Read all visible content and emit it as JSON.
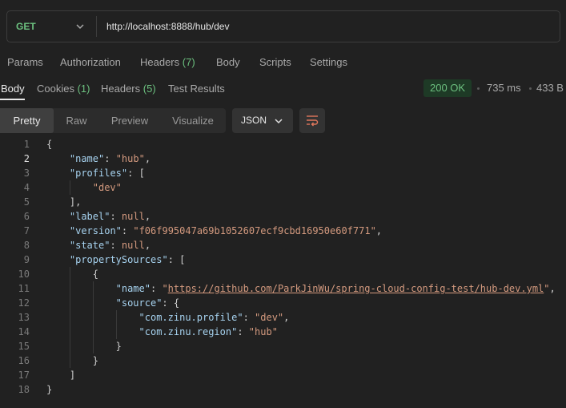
{
  "request": {
    "method": "GET",
    "url": "http://localhost:8888/hub/dev"
  },
  "request_tabs": [
    {
      "label": "Params"
    },
    {
      "label": "Authorization"
    },
    {
      "label": "Headers",
      "count": "(7)"
    },
    {
      "label": "Body"
    },
    {
      "label": "Scripts"
    },
    {
      "label": "Settings"
    }
  ],
  "response_tabs": [
    {
      "label": "Body"
    },
    {
      "label": "Cookies",
      "count": "(1)"
    },
    {
      "label": "Headers",
      "count": "(5)"
    },
    {
      "label": "Test Results"
    }
  ],
  "response_meta": {
    "status": "200 OK",
    "time": "735 ms",
    "size": "433 B"
  },
  "view_modes": [
    "Pretty",
    "Raw",
    "Preview",
    "Visualize"
  ],
  "format": "JSON",
  "colors": {
    "method": "#6cc07f",
    "status_bg": "#1e3a26",
    "json_key": "#a7d3f0",
    "json_string": "#d49a7f"
  },
  "icons": {
    "method_dropdown": "chevron-down-icon",
    "format_dropdown": "chevron-down-icon",
    "wrap": "wrap-lines-icon"
  },
  "code_lines": [
    {
      "n": "1",
      "ind": 0,
      "toks": [
        {
          "t": "p",
          "v": "{"
        }
      ]
    },
    {
      "n": "2",
      "ind": 1,
      "toks": [
        {
          "t": "k",
          "v": "\"name\""
        },
        {
          "t": "p",
          "v": ": "
        },
        {
          "t": "s",
          "v": "\"hub\""
        },
        {
          "t": "p",
          "v": ","
        }
      ]
    },
    {
      "n": "3",
      "ind": 1,
      "toks": [
        {
          "t": "k",
          "v": "\"profiles\""
        },
        {
          "t": "p",
          "v": ": ["
        }
      ]
    },
    {
      "n": "4",
      "ind": 2,
      "toks": [
        {
          "t": "s",
          "v": "\"dev\""
        }
      ]
    },
    {
      "n": "5",
      "ind": 1,
      "toks": [
        {
          "t": "p",
          "v": "],"
        }
      ]
    },
    {
      "n": "6",
      "ind": 1,
      "toks": [
        {
          "t": "k",
          "v": "\"label\""
        },
        {
          "t": "p",
          "v": ": "
        },
        {
          "t": "n",
          "v": "null"
        },
        {
          "t": "p",
          "v": ","
        }
      ]
    },
    {
      "n": "7",
      "ind": 1,
      "toks": [
        {
          "t": "k",
          "v": "\"version\""
        },
        {
          "t": "p",
          "v": ": "
        },
        {
          "t": "s",
          "v": "\"f06f995047a69b1052607ecf9cbd16950e60f771\""
        },
        {
          "t": "p",
          "v": ","
        }
      ]
    },
    {
      "n": "8",
      "ind": 1,
      "toks": [
        {
          "t": "k",
          "v": "\"state\""
        },
        {
          "t": "p",
          "v": ": "
        },
        {
          "t": "n",
          "v": "null"
        },
        {
          "t": "p",
          "v": ","
        }
      ]
    },
    {
      "n": "9",
      "ind": 1,
      "toks": [
        {
          "t": "k",
          "v": "\"propertySources\""
        },
        {
          "t": "p",
          "v": ": ["
        }
      ]
    },
    {
      "n": "10",
      "ind": 2,
      "toks": [
        {
          "t": "p",
          "v": "{"
        }
      ]
    },
    {
      "n": "11",
      "ind": 3,
      "toks": [
        {
          "t": "k",
          "v": "\"name\""
        },
        {
          "t": "p",
          "v": ": "
        },
        {
          "t": "s",
          "v": "\""
        },
        {
          "t": "u",
          "v": "https://github.com/ParkJinWu/spring-cloud-config-test/hub-dev.yml"
        },
        {
          "t": "s",
          "v": "\""
        },
        {
          "t": "p",
          "v": ","
        }
      ]
    },
    {
      "n": "12",
      "ind": 3,
      "toks": [
        {
          "t": "k",
          "v": "\"source\""
        },
        {
          "t": "p",
          "v": ": {"
        }
      ]
    },
    {
      "n": "13",
      "ind": 4,
      "toks": [
        {
          "t": "k",
          "v": "\"com.zinu.profile\""
        },
        {
          "t": "p",
          "v": ": "
        },
        {
          "t": "s",
          "v": "\"dev\""
        },
        {
          "t": "p",
          "v": ","
        }
      ]
    },
    {
      "n": "14",
      "ind": 4,
      "toks": [
        {
          "t": "k",
          "v": "\"com.zinu.region\""
        },
        {
          "t": "p",
          "v": ": "
        },
        {
          "t": "s",
          "v": "\"hub\""
        }
      ]
    },
    {
      "n": "15",
      "ind": 3,
      "toks": [
        {
          "t": "p",
          "v": "}"
        }
      ]
    },
    {
      "n": "16",
      "ind": 2,
      "toks": [
        {
          "t": "p",
          "v": "}"
        }
      ]
    },
    {
      "n": "17",
      "ind": 1,
      "toks": [
        {
          "t": "p",
          "v": "]"
        }
      ]
    },
    {
      "n": "18",
      "ind": 0,
      "toks": [
        {
          "t": "p",
          "v": "}"
        }
      ]
    }
  ]
}
